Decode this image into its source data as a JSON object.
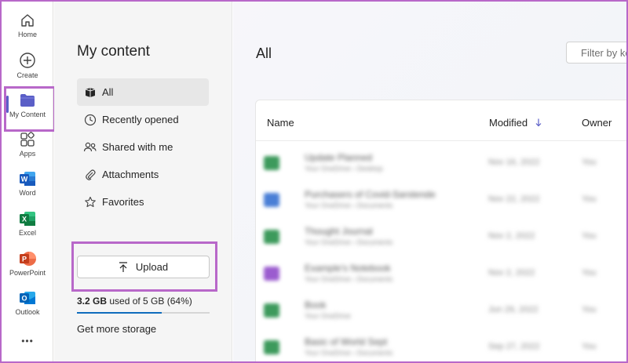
{
  "rail": {
    "items": [
      {
        "label": "Home",
        "icon": "home-icon"
      },
      {
        "label": "Create",
        "icon": "plus-circle-icon"
      },
      {
        "label": "My Content",
        "icon": "folder-icon"
      },
      {
        "label": "Apps",
        "icon": "apps-grid-icon"
      },
      {
        "label": "Word",
        "icon": "word-app-icon"
      },
      {
        "label": "Excel",
        "icon": "excel-app-icon"
      },
      {
        "label": "PowerPoint",
        "icon": "powerpoint-app-icon"
      },
      {
        "label": "Outlook",
        "icon": "outlook-app-icon"
      }
    ],
    "more": "•••",
    "word_letter": "W",
    "excel_letter": "X",
    "powerpoint_letter": "P",
    "outlook_letter": "O"
  },
  "nav": {
    "title": "My content",
    "items": [
      {
        "label": "All",
        "icon": "all-content-icon"
      },
      {
        "label": "Recently opened",
        "icon": "clock-icon"
      },
      {
        "label": "Shared with me",
        "icon": "people-icon"
      },
      {
        "label": "Attachments",
        "icon": "paperclip-icon"
      },
      {
        "label": "Favorites",
        "icon": "star-icon"
      }
    ],
    "upload_label": "Upload",
    "storage_used": "3.2 GB",
    "storage_rest": " used of 5 GB (64%)",
    "storage_fraction": 0.64,
    "get_more": "Get more storage"
  },
  "main": {
    "title": "All",
    "filter_placeholder": "Filter by keyword",
    "columns": {
      "name": "Name",
      "modified": "Modified",
      "owner": "Owner"
    },
    "sort_icon": "arrow-down-icon",
    "rows": [
      {
        "name": "Update Planned",
        "location": "Your OneDrive › Desktop",
        "modified": "Nov 16, 2022",
        "owner": "You",
        "color": "#3d9a5c"
      },
      {
        "name": "Purchasers of Covid-Sarstende",
        "location": "Your OneDrive › Documents",
        "modified": "Nov 22, 2022",
        "owner": "You",
        "color": "#4a7fd6"
      },
      {
        "name": "Thought Journal",
        "location": "Your OneDrive › Documents",
        "modified": "Nov 2, 2022",
        "owner": "You",
        "color": "#3d9a5c"
      },
      {
        "name": "Example's Notebook",
        "location": "Your OneDrive › Documents",
        "modified": "Nov 2, 2022",
        "owner": "You",
        "color": "#9b5ccf"
      },
      {
        "name": "Book",
        "location": "Your OneDrive",
        "modified": "Jun 29, 2022",
        "owner": "You",
        "color": "#3d9a5c"
      },
      {
        "name": "Basic of World Sept",
        "location": "Your OneDrive › Documents",
        "modified": "Sep 27, 2022",
        "owner": "You",
        "color": "#3d9a5c"
      }
    ]
  },
  "colors": {
    "accent": "#5b5fc7",
    "highlight": "#b868c9",
    "progress": "#0f6cbd"
  }
}
